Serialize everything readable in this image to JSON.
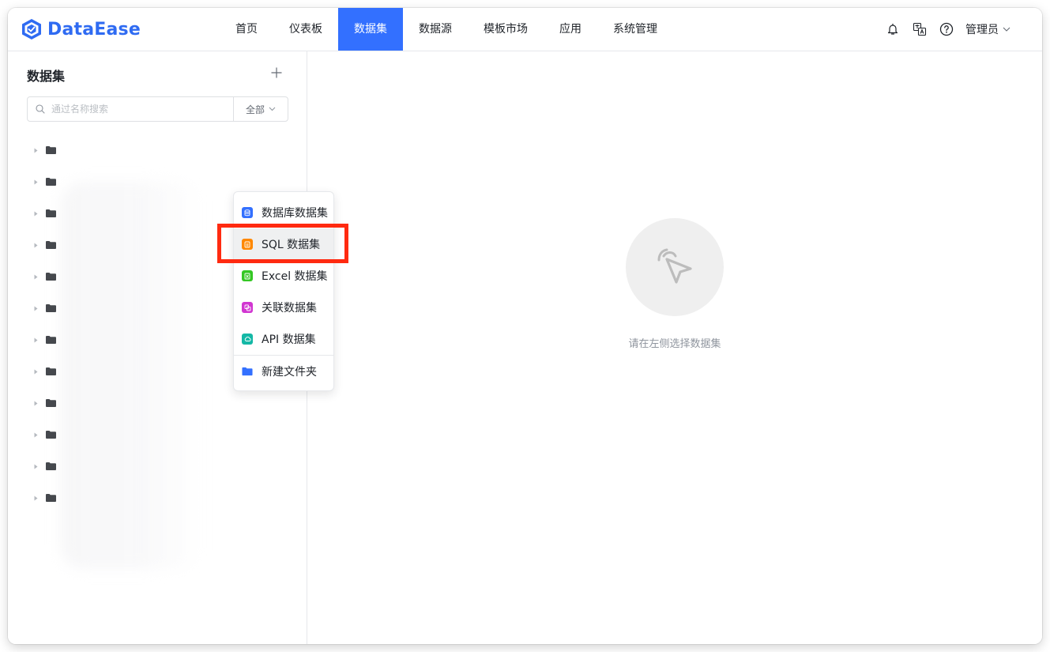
{
  "app": {
    "logo_text": "DataEase",
    "brand_color": "#2f6bf2"
  },
  "nav": {
    "items": [
      {
        "label": "首页"
      },
      {
        "label": "仪表板"
      },
      {
        "label": "数据集",
        "active": true
      },
      {
        "label": "数据源"
      },
      {
        "label": "模板市场"
      },
      {
        "label": "应用"
      },
      {
        "label": "系统管理"
      }
    ],
    "active_color": "#3370ff"
  },
  "header_right": {
    "icons": [
      "notification-icon",
      "translate-icon",
      "help-icon"
    ],
    "user_label": "管理员"
  },
  "sidebar": {
    "title": "数据集",
    "search_placeholder": "通过名称搜索",
    "filter_label": "全部",
    "tree_row_count": 12
  },
  "dropdown": {
    "items": [
      {
        "label": "数据库数据集",
        "icon": "database-icon",
        "color": "#3370ff"
      },
      {
        "label": "SQL 数据集",
        "icon": "sql-icon",
        "color": "#ff8800",
        "hovered": true
      },
      {
        "label": "Excel 数据集",
        "icon": "excel-icon",
        "color": "#34c724"
      },
      {
        "label": "关联数据集",
        "icon": "union-icon",
        "color": "#d136d1"
      },
      {
        "label": "API 数据集",
        "icon": "api-icon",
        "color": "#14b8a6"
      },
      {
        "label": "新建文件夹",
        "icon": "folder-icon",
        "color": "#3370ff"
      }
    ],
    "highlight_color": "#ff2a10"
  },
  "main": {
    "empty_text": "请在左侧选择数据集"
  }
}
